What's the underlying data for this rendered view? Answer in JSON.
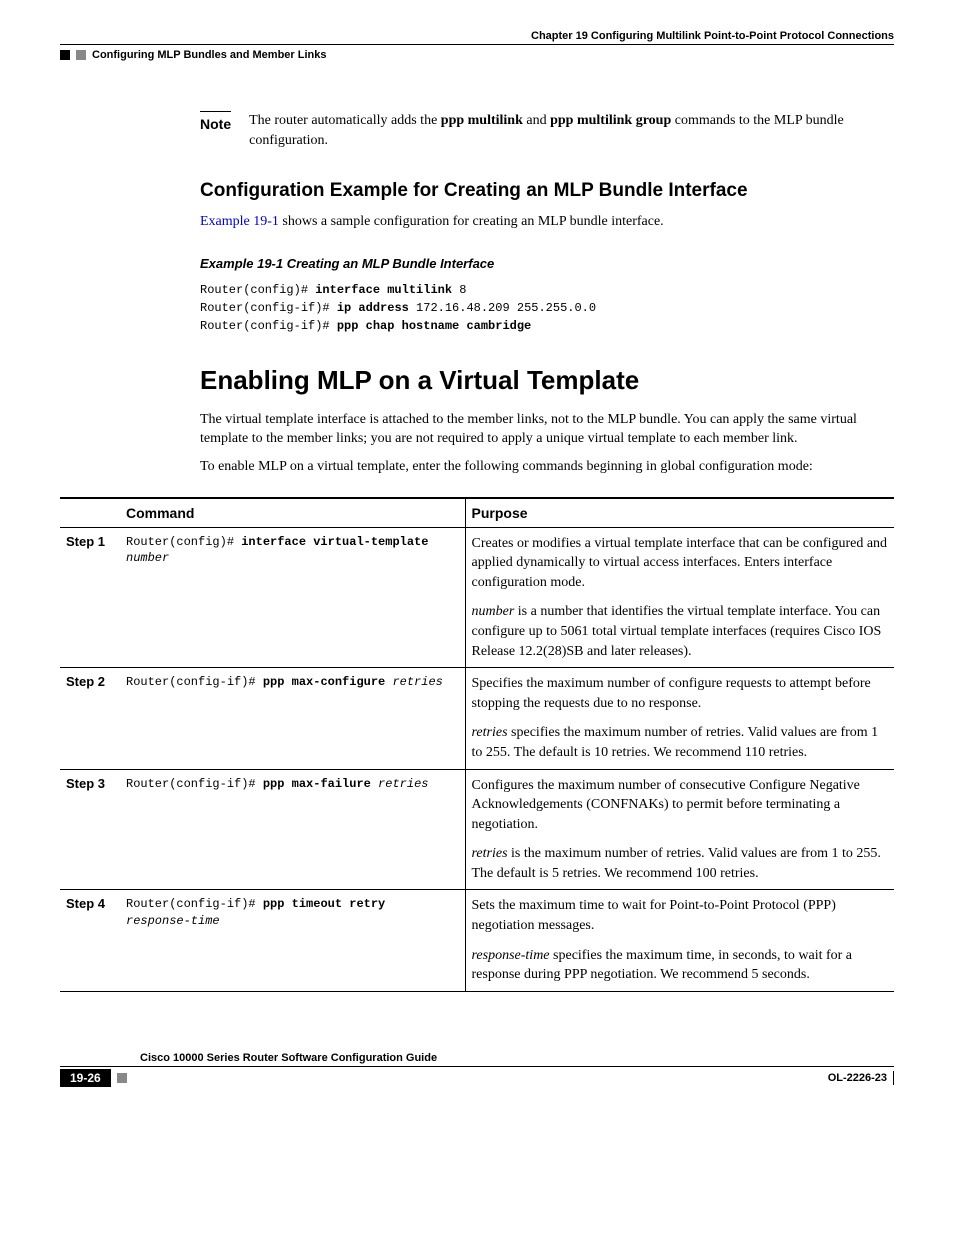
{
  "header": {
    "chapter": "Chapter 19      Configuring Multilink Point-to-Point Protocol Connections",
    "section": "Configuring MLP Bundles and Member Links"
  },
  "note": {
    "label": "Note",
    "text_pre": "The router automatically adds the ",
    "bold1": "ppp multilink",
    "text_mid": " and ",
    "bold2": "ppp multilink group",
    "text_post": " commands to the MLP bundle configuration."
  },
  "h2_config_example": "Configuration Example for Creating an MLP Bundle Interface",
  "intro_para": {
    "link": "Example 19-1",
    "rest": " shows a sample configuration for creating an MLP bundle interface."
  },
  "example_title": "Example 19-1   Creating an MLP Bundle Interface",
  "example_code": {
    "l1_prompt": "Router(config)# ",
    "l1_bold": "interface multilink",
    "l1_arg": " 8",
    "l2_prompt": "Router(config-if)# ",
    "l2_bold": "ip address",
    "l2_arg": " 172.16.48.209 255.255.0.0",
    "l3_prompt": "Router(config-if)# ",
    "l3_bold": "ppp chap hostname cambridge"
  },
  "h1_enable": "Enabling MLP on a Virtual Template",
  "enable_p1": "The virtual template interface is attached to the member links, not to the MLP bundle. You can apply the same virtual template to the member links; you are not required to apply a unique virtual template to each member link.",
  "enable_p2": "To enable MLP on a virtual template, enter the following commands beginning in global configuration mode:",
  "table": {
    "headers": {
      "cmd": "Command",
      "purpose": "Purpose"
    },
    "rows": [
      {
        "step": "Step 1",
        "cmd_prompt": "Router(config)# ",
        "cmd_bold": "interface virtual-template",
        "cmd_br": true,
        "cmd_italic": "number",
        "purpose_p1": "Creates or modifies a virtual template interface that can be configured and applied dynamically to virtual access interfaces. Enters interface configuration mode.",
        "purpose_p2_i": "number",
        "purpose_p2_rest": " is a number that identifies the virtual template interface. You can configure up to 5061 total virtual template interfaces (requires Cisco IOS Release 12.2(28)SB and later releases)."
      },
      {
        "step": "Step 2",
        "cmd_prompt": "Router(config-if)# ",
        "cmd_bold": "ppp max-configure",
        "cmd_italic": " retries",
        "purpose_p1": "Specifies the maximum number of configure requests to attempt before stopping the requests due to no response.",
        "purpose_p2_i": "retries",
        "purpose_p2_rest": " specifies the maximum number of retries. Valid values are from 1 to 255. The default is 10 retries. We recommend 110 retries."
      },
      {
        "step": "Step 3",
        "cmd_prompt": "Router(config-if)# ",
        "cmd_bold": "ppp max-failure",
        "cmd_italic": " retries",
        "purpose_p1": "Configures the maximum number of consecutive Configure Negative Acknowledgements (CONFNAKs) to permit before terminating a negotiation.",
        "purpose_p2_i": "retries",
        "purpose_p2_rest": " is the maximum number of retries. Valid values are from 1 to 255. The default is 5 retries. We recommend 100 retries."
      },
      {
        "step": "Step 4",
        "cmd_prompt": "Router(config-if)# ",
        "cmd_bold": "ppp timeout retry",
        "cmd_br": true,
        "cmd_italic": "response-time",
        "purpose_p1": "Sets the maximum time to wait for Point-to-Point Protocol (PPP) negotiation messages.",
        "purpose_p2_i": "response-time",
        "purpose_p2_rest": " specifies the maximum time, in seconds, to wait for a response during PPP negotiation. We recommend 5 seconds."
      }
    ]
  },
  "footer": {
    "guide": "Cisco 10000 Series Router Software Configuration Guide",
    "page": "19-26",
    "ol": "OL-2226-23"
  }
}
